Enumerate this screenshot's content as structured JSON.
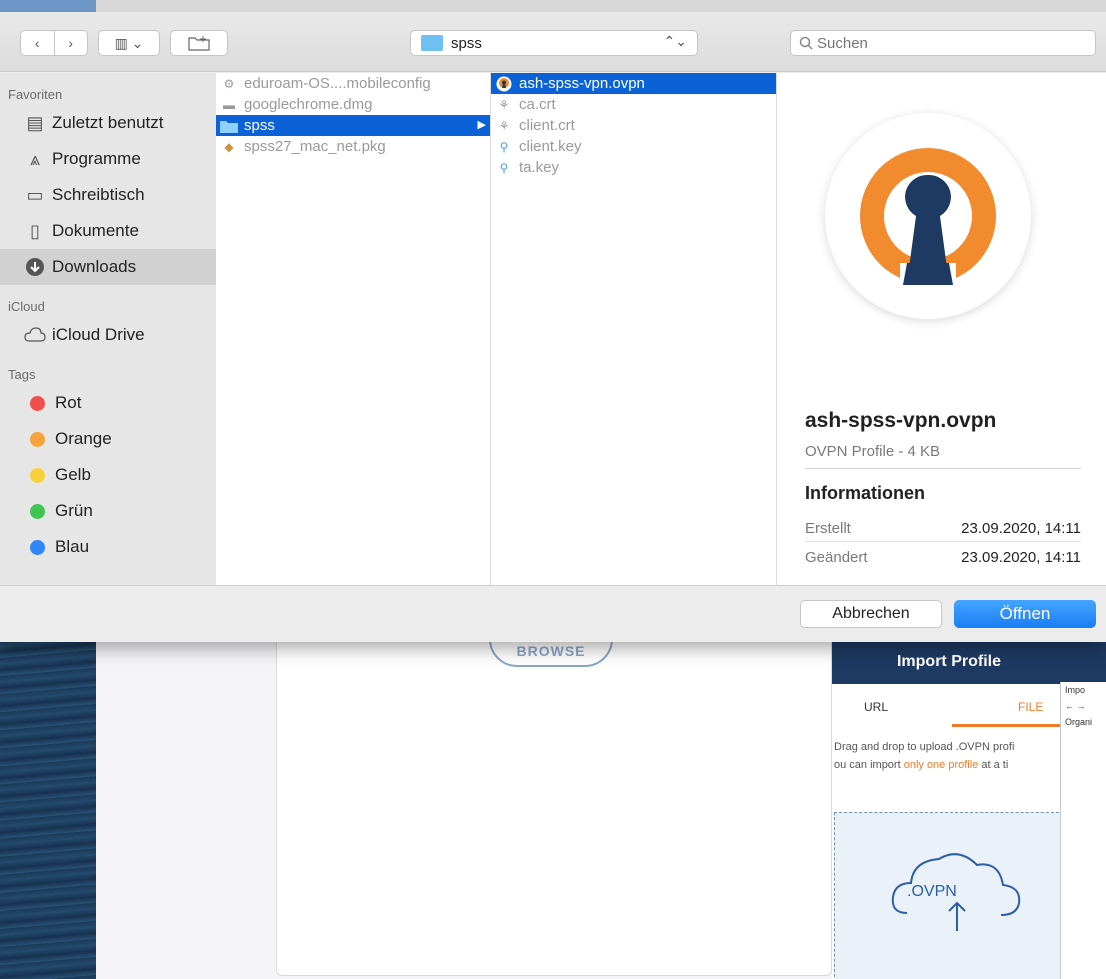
{
  "toolbar": {
    "back_glyph": "‹",
    "forward_glyph": "›",
    "view_glyph": "▥ ⌄",
    "new_folder_glyph": "⊞",
    "path_label": "spss",
    "path_updown_glyph": "⌃⌄",
    "search_placeholder": "Suchen"
  },
  "sidebar": {
    "favorites_heading": "Favoriten",
    "favorites": [
      {
        "label": "Zuletzt benutzt",
        "icon": "recents-icon"
      },
      {
        "label": "Programme",
        "icon": "applications-icon"
      },
      {
        "label": "Schreibtisch",
        "icon": "desktop-icon"
      },
      {
        "label": "Dokumente",
        "icon": "documents-icon"
      },
      {
        "label": "Downloads",
        "icon": "downloads-icon"
      }
    ],
    "icloud_heading": "iCloud",
    "icloud": [
      {
        "label": "iCloud Drive",
        "icon": "cloud-icon"
      }
    ],
    "tags_heading": "Tags",
    "tags": [
      {
        "label": "Rot",
        "color": "#f0504c"
      },
      {
        "label": "Orange",
        "color": "#f5a33a"
      },
      {
        "label": "Gelb",
        "color": "#f8cf3d"
      },
      {
        "label": "Grün",
        "color": "#3fc552"
      },
      {
        "label": "Blau",
        "color": "#2f86f6"
      }
    ]
  },
  "column1": {
    "items": [
      {
        "name": "eduroam-OS....mobileconfig",
        "icon": "config-file-icon"
      },
      {
        "name": "googlechrome.dmg",
        "icon": "disk-image-icon"
      },
      {
        "name": "spss",
        "icon": "folder-icon"
      },
      {
        "name": "spss27_mac_net.pkg",
        "icon": "package-icon"
      }
    ]
  },
  "column2": {
    "items": [
      {
        "name": "ash-spss-vpn.ovpn",
        "icon": "openvpn-icon"
      },
      {
        "name": "ca.crt",
        "icon": "certificate-icon"
      },
      {
        "name": "client.crt",
        "icon": "certificate-icon"
      },
      {
        "name": "client.key",
        "icon": "key-file-icon"
      },
      {
        "name": "ta.key",
        "icon": "key-file-icon"
      }
    ]
  },
  "preview": {
    "title": "ash-spss-vpn.ovpn",
    "subtitle": "OVPN Profile - 4 KB",
    "info_heading": "Informationen",
    "created_label": "Erstellt",
    "created_value": "23.09.2020, 14:11",
    "modified_label": "Geändert",
    "modified_value": "23.09.2020, 14:11"
  },
  "footer": {
    "cancel_label": "Abbrechen",
    "open_label": "Öffnen"
  },
  "background": {
    "browse_label": "BROWSE",
    "import_title": "Import Profile",
    "tab_url": "URL",
    "tab_file": "FILE",
    "drag_text_prefix": "Drag and drop to upload .OVPN profi",
    "import_text_2_prefix": "ou can import ",
    "import_text_2_highlight": "only one profile",
    "import_text_2_suffix": " at a ti",
    "ovpn_label": ".OVPN",
    "mini_title": "Impo",
    "mini_organize": "Organi"
  }
}
